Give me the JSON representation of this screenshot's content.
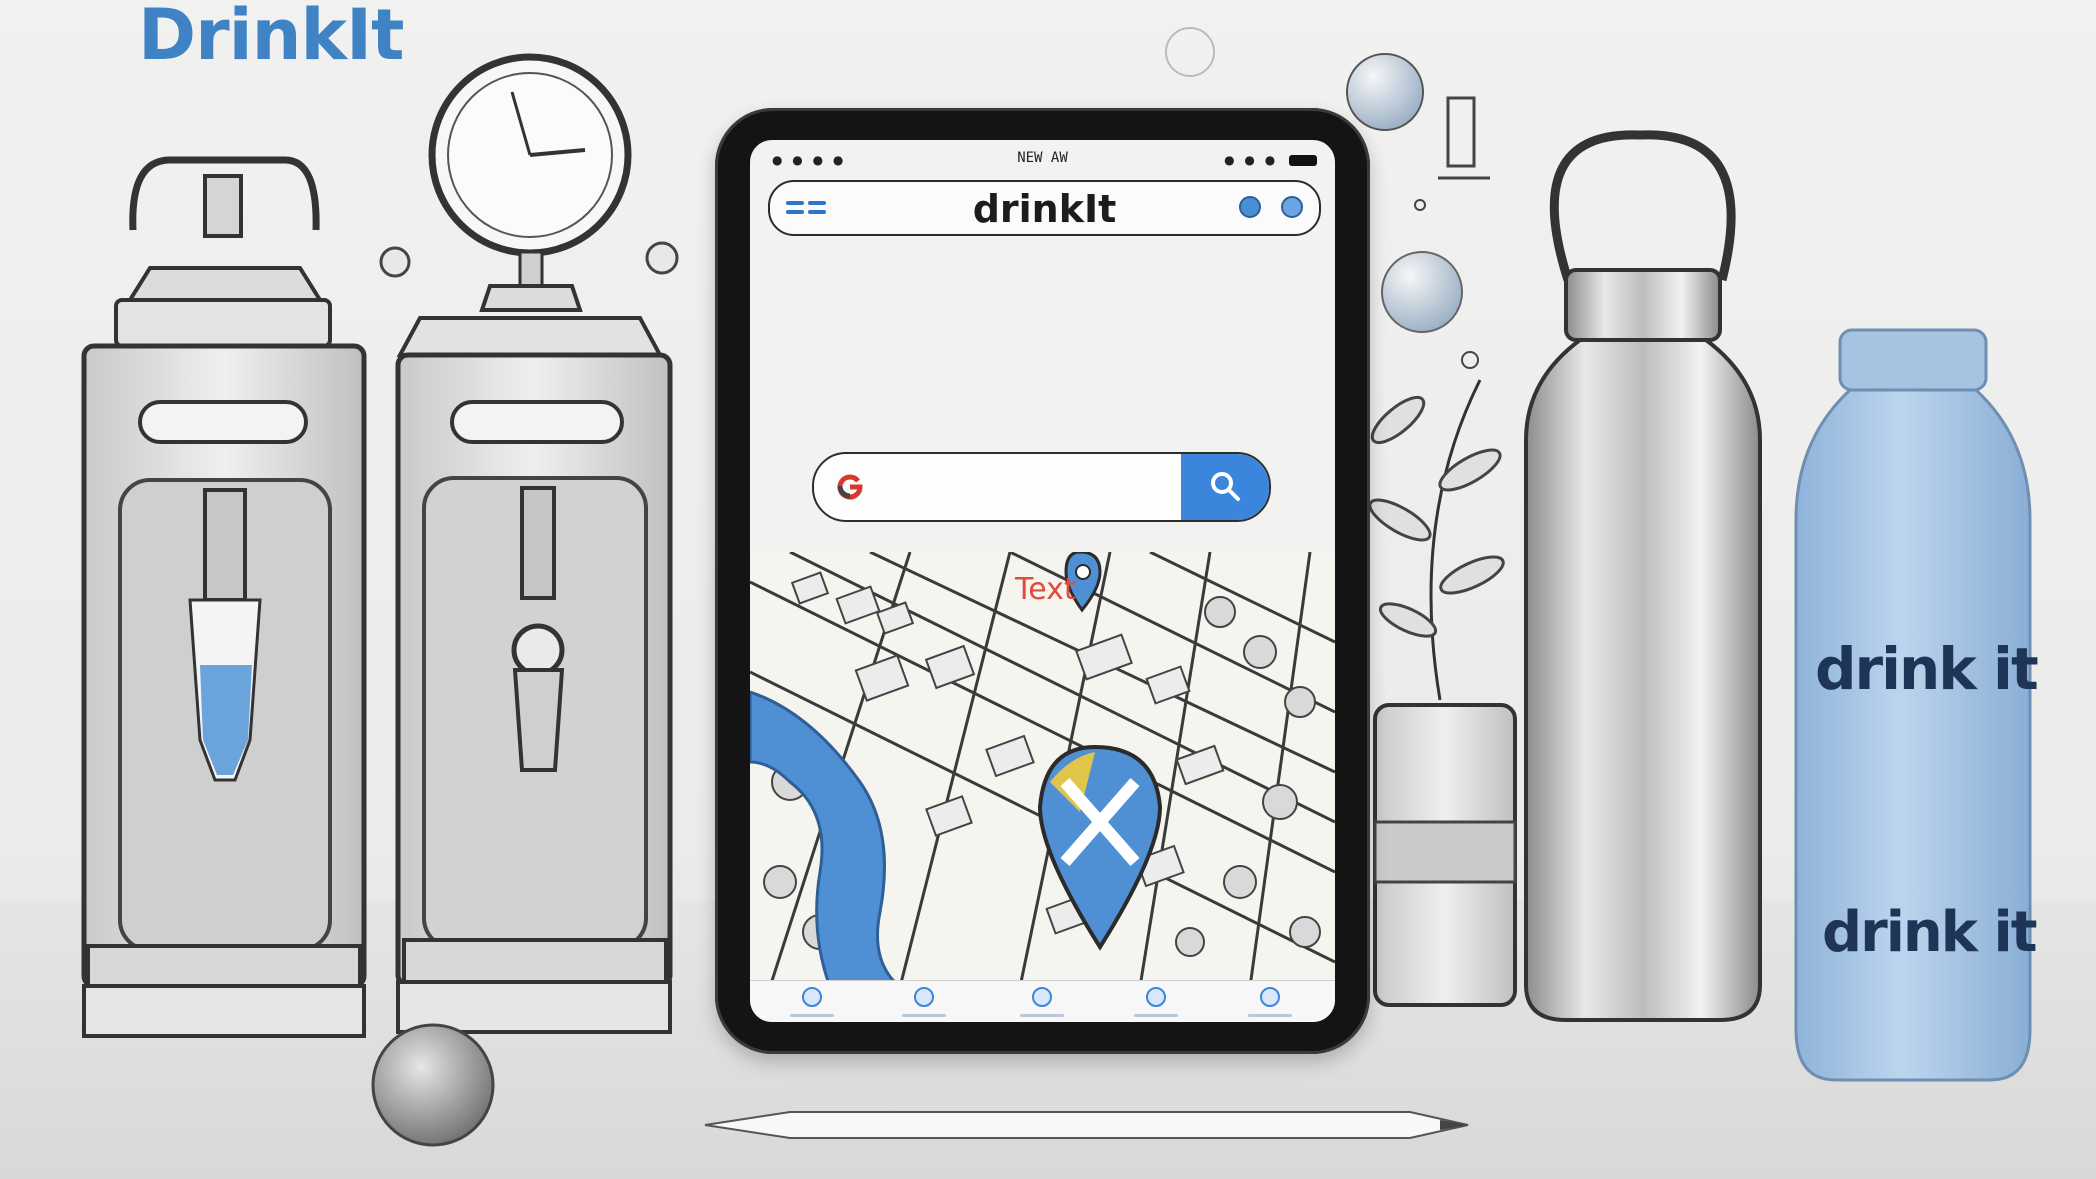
{
  "brand": {
    "logo_text": "DrinkIt"
  },
  "tablet": {
    "status_bar": {
      "time": "NEW AW"
    },
    "header": {
      "title": "drinkIt"
    },
    "search": {
      "placeholder": ""
    },
    "map": {
      "label": "Text"
    },
    "bottom_nav": {
      "items": [
        {
          "icon": "home-icon"
        },
        {
          "icon": "info-icon"
        },
        {
          "icon": "map-icon"
        },
        {
          "icon": "favorite-icon"
        },
        {
          "icon": "profile-icon"
        }
      ]
    }
  },
  "bottle": {
    "label_top": "drink it",
    "label_bottom": "drink it"
  },
  "colors": {
    "brand_blue": "#3f83c4",
    "search_button": "#3b86dc",
    "river": "#4f8fd4",
    "bottle_blue": "#a9c7e6",
    "map_pin_yellow": "#e0c54a"
  }
}
